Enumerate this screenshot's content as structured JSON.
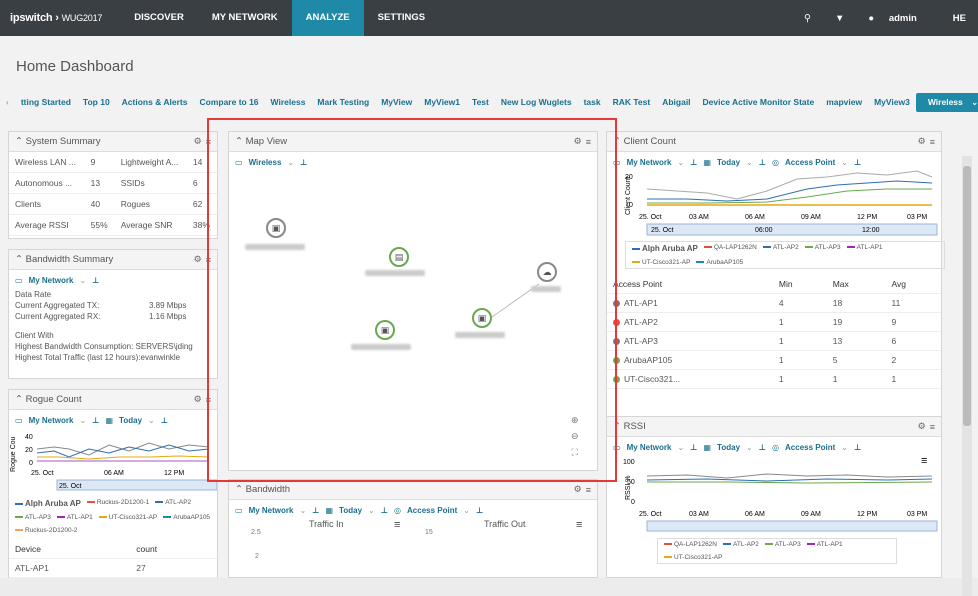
{
  "brand": {
    "name": "ipswitch",
    "suffix": "WUG2017"
  },
  "nav": [
    "DISCOVER",
    "MY NETWORK",
    "ANALYZE",
    "SETTINGS"
  ],
  "user": "admin",
  "help": "HE",
  "page_title": "Home Dashboard",
  "tabs": [
    "tting Started",
    "Top 10",
    "Actions & Alerts",
    "Compare to 16",
    "Wireless",
    "Mark Testing",
    "MyView",
    "MyView1",
    "Test",
    "New Log Wuglets",
    "task",
    "RAK Test",
    "Abigail",
    "Device Active Monitor State",
    "mapview",
    "MyView3"
  ],
  "tab_selected": "Wireless",
  "system_summary": {
    "title": "System Summary",
    "rows": [
      [
        "Wireless LAN ...",
        "9",
        "Lightweight A...",
        "14"
      ],
      [
        "Autonomous ...",
        "13",
        "SSIDs",
        "6"
      ],
      [
        "Clients",
        "40",
        "Rogues",
        "62"
      ],
      [
        "Average RSSI",
        "55%",
        "Average SNR",
        "38%"
      ]
    ]
  },
  "bandwidth_summary": {
    "title": "Bandwidth Summary",
    "crumb": "My Network",
    "data_rate": "Data Rate",
    "tx_label": "Current Aggregated TX:",
    "tx": "3.89 Mbps",
    "rx_label": "Current Aggregated RX:",
    "rx": "1.16 Mbps",
    "client_with": "Client With",
    "hb_label": "Highest Bandwidth Consumption:",
    "hb": "SERVERS\\jding",
    "ht_label": "Highest Total Traffic (last 12 hours):",
    "ht": "evanwinkle"
  },
  "rogue_count": {
    "title": "Rogue Count",
    "crumb": "My Network",
    "range": "Today",
    "ylabel": "Rogue Cou",
    "y_ticks": [
      "40",
      "20",
      "0"
    ],
    "x_ticks": [
      "25. Oct",
      "06 AM",
      "12 PM"
    ],
    "nav_label": "25. Oct",
    "legend": [
      "Alph Aruba AP",
      "Ruckus-2D1200-1",
      "ATL-AP2",
      "ATL-AP3",
      "ATL-AP1",
      "UT-Cisco321-AP",
      "ArubaAP105",
      "Ruckus-2D1200-2"
    ],
    "col_device": "Device",
    "col_count": "count",
    "first_row": [
      "ATL-AP1",
      "27"
    ]
  },
  "map_view": {
    "title": "Map View",
    "crumb": "Wireless"
  },
  "bandwidth": {
    "title": "Bandwidth",
    "crumb": "My Network",
    "range": "Today",
    "filter": "Access Point",
    "traffic_in": "Traffic In",
    "traffic_out": "Traffic Out",
    "in_ticks": [
      "2.5",
      "2"
    ],
    "out_ticks": [
      "15"
    ]
  },
  "client_count": {
    "title": "Client Count",
    "crumb": "My Network",
    "range": "Today",
    "filter": "Access Point",
    "ylabel": "Client Count",
    "y_ticks": [
      "20",
      "0"
    ],
    "x_ticks": [
      "25. Oct",
      "03 AM",
      "06 AM",
      "09 AM",
      "12 PM",
      "03 PM"
    ],
    "nav_ticks": [
      "25. Oct",
      "06:00",
      "12:00"
    ],
    "legend": [
      "Alph Aruba AP",
      "QA-LAP1262N",
      "ATL-AP2",
      "ATL-AP3",
      "ATL-AP1",
      "UT-Cisco321-AP",
      "ArubaAP105"
    ],
    "cols": [
      "Access Point",
      "Min",
      "Max",
      "Avg"
    ],
    "rows": [
      [
        "ATL-AP1",
        "4",
        "18",
        "11"
      ],
      [
        "ATL-AP2",
        "1",
        "19",
        "9"
      ],
      [
        "ATL-AP3",
        "1",
        "13",
        "6"
      ],
      [
        "ArubaAP105",
        "1",
        "5",
        "2"
      ],
      [
        "UT-Cisco321...",
        "1",
        "1",
        "1"
      ]
    ]
  },
  "rssi": {
    "title": "RSSI",
    "crumb": "My Network",
    "range": "Today",
    "filter": "Access Point",
    "ylabel": "RSSI %",
    "y_ticks": [
      "100",
      "50",
      "0"
    ],
    "x_ticks": [
      "25. Oct",
      "03 AM",
      "06 AM",
      "09 AM",
      "12 PM",
      "03 PM"
    ],
    "legend": [
      "QA-LAP1262N",
      "ATL-AP2",
      "ATL-AP3",
      "ATL-AP1",
      "UT-Cisco321-AP"
    ]
  }
}
